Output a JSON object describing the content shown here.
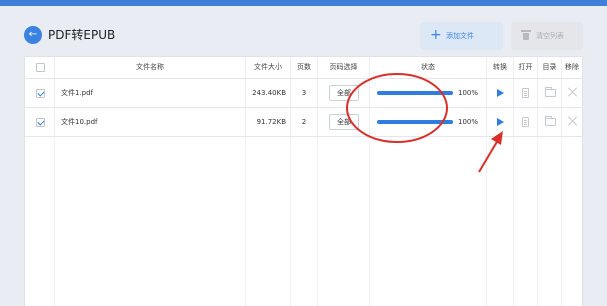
{
  "header": {
    "back_icon": "arrow-left-icon",
    "title": "PDF转EPUB",
    "add_button": {
      "icon": "plus-icon",
      "label": "添加文件"
    },
    "clear_button": {
      "icon": "trash-icon",
      "label": "清空列表",
      "disabled": true
    }
  },
  "table": {
    "columns": {
      "name": "文件名称",
      "size": "文件大小",
      "pages": "页数",
      "page_select": "页码选择",
      "status": "状态",
      "convert": "转换",
      "open": "打开",
      "folder": "目录",
      "remove": "移除"
    },
    "rows": [
      {
        "checked": true,
        "name": "文件1.pdf",
        "size": "243.40KB",
        "pages": "3",
        "page_select": "全部",
        "progress": 1.0,
        "progress_text": "100%"
      },
      {
        "checked": true,
        "name": "文件10.pdf",
        "size": "91.72KB",
        "pages": "2",
        "page_select": "全部",
        "progress": 1.0,
        "progress_text": "100%"
      }
    ]
  },
  "annotations": {
    "ellipse_color": "#d9302a",
    "arrow_color": "#d9302a"
  },
  "colors": {
    "accent": "#2f7de0",
    "top_strip": "#3f7fd8",
    "background": "#e9edf3"
  }
}
